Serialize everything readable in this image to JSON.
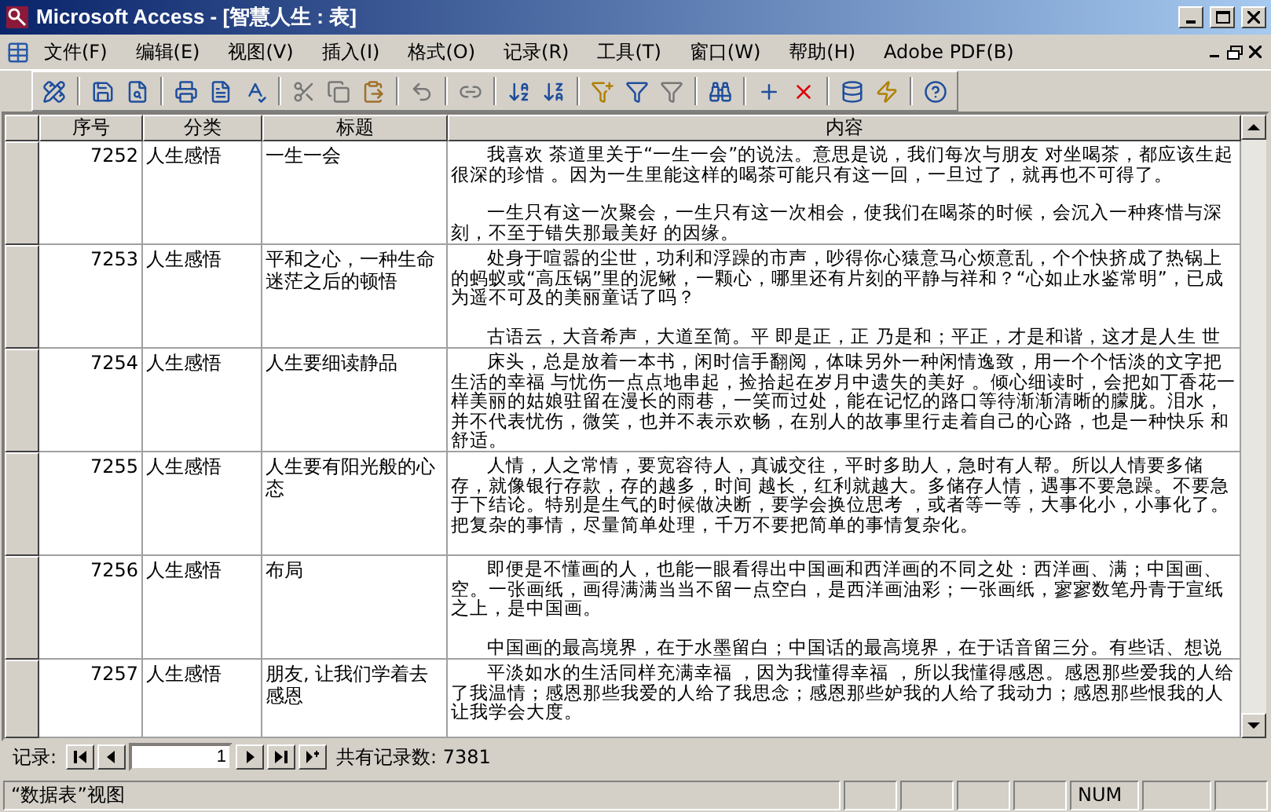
{
  "window": {
    "title": "Microsoft Access - [智慧人生 : 表]"
  },
  "menu": [
    "文件(F)",
    "编辑(E)",
    "视图(V)",
    "插入(I)",
    "格式(O)",
    "记录(R)",
    "工具(T)",
    "窗口(W)",
    "帮助(H)",
    "Adobe PDF(B)"
  ],
  "table": {
    "columns": [
      "序号",
      "分类",
      "标题",
      "内容"
    ],
    "rows": [
      {
        "id": "7252",
        "category": "人生感悟",
        "title": "一生一会",
        "content": [
          "我喜欢 茶道里关于“一生一会”的说法。意思是说，我们每次与朋友 对坐喝茶，都应该生起很深的珍惜 。因为一生里能这样的喝茶可能只有这一回，一旦过了，就再也不可得了。",
          "一生只有这一次聚会，一生只有这一次相会，使我们在喝茶的时候，会沉入一种疼惜与深刻，不至于错失那最美好 的因缘。"
        ]
      },
      {
        "id": "7253",
        "category": "人生感悟",
        "title": "平和之心，一种生命迷茫之后的顿悟",
        "content": [
          "处身于喧嚣的尘世，功利和浮躁的市声，吵得你心猿意马心烦意乱，个个快挤成了热锅上的蚂蚁或“高压锅”里的泥鳅，一颗心，哪里还有片刻的平静与祥和？“心如止水鉴常明”，已成为遥不可及的美丽童话了吗？",
          "古语云，大音希声，大道至简。平 即是正，正 乃是和；平正，才是和谐，这才是人生 世"
        ]
      },
      {
        "id": "7254",
        "category": "人生感悟",
        "title": "人生要细读静品",
        "content": [
          "床头，总是放着一本书，闲时信手翻阅，体味另外一种闲情逸致，用一个个恬淡的文字把生活的幸福 与忧伤一点点地串起，捡拾起在岁月中遗失的美好 。倾心细读时，会把如丁香花一样美丽的姑娘驻留在漫长的雨巷，一笑而过处，能在记忆的路口等待渐渐清晰的朦胧。泪水，并不代表忧伤，微笑，也并不表示欢畅，在别人的故事里行走着自己的心路，也是一种快乐 和舒适。"
        ]
      },
      {
        "id": "7255",
        "category": "人生感悟",
        "title": "人生要有阳光般的心态",
        "content": [
          "人情，人之常情，要宽容待人，真诚交往，平时多助人，急时有人帮。所以人情要多储存，就像银行存款，存的越多，时间 越长，红利就越大。多储存人情，遇事不要急躁。不要急于下结论。特别是生气的时候做决断，要学会换位思考 ，或者等一等，大事化小，小事化了。把复杂的事情，尽量简单处理，千万不要把简单的事情复杂化。"
        ]
      },
      {
        "id": "7256",
        "category": "人生感悟",
        "title": "布局",
        "content": [
          "即便是不懂画的人，也能一眼看得出中国画和西洋画的不同之处：西洋画、满；中国画、空。一张画纸，画得满满当当不留一点空白，是西洋画油彩；一张画纸，寥寥数笔丹青于宣纸之上，是中国画。",
          "中国画的最高境界，在于水墨留白；中国话的最高境界，在于话音留三分。有些话、想说"
        ]
      },
      {
        "id": "7257",
        "category": "人生感悟",
        "title": "朋友, 让我们学着去感恩",
        "content": [
          "平淡如水的生活同样充满幸福 ，因为我懂得幸福 ，所以我懂得感恩。感恩那些爱我的人给了我温情；感恩那些我爱的人给了我思念；感恩那些妒我的人给了我动力；感恩那些恨我的人让我学会大度。"
        ]
      }
    ]
  },
  "navigator": {
    "label": "记录:",
    "current": "1",
    "count": "共有记录数: 7381"
  },
  "status_bar": {
    "view": "“数据表”视图",
    "num": "NUM"
  }
}
